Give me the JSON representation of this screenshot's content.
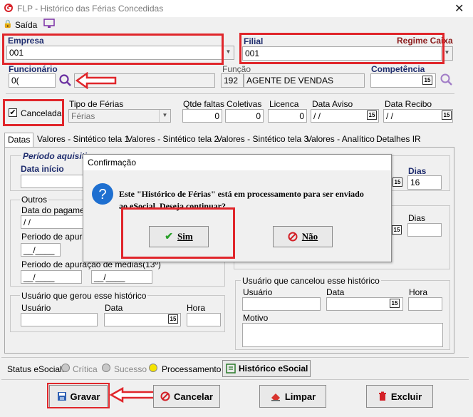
{
  "window": {
    "title": "FLP - Histórico das Férias Concedidas",
    "close": "✕"
  },
  "menu": {
    "saida": "Saída"
  },
  "empresa": {
    "label": "Empresa",
    "value": "001"
  },
  "filial": {
    "label": "Filial",
    "value": "001",
    "regime_label": "Regime Caixa"
  },
  "funcionario": {
    "label": "Funcionário",
    "value": "0("
  },
  "funcao": {
    "label": "Função",
    "code": "192",
    "name": "AGENTE DE VENDAS"
  },
  "competencia": {
    "label": "Competência",
    "value": ""
  },
  "cancelada": {
    "label": "Cancelada",
    "checked": true
  },
  "tipo_ferias": {
    "label": "Tipo de Férias",
    "value": "Férias"
  },
  "qtde_faltas": {
    "label": "Qtde faltas",
    "value": "0"
  },
  "coletivas": {
    "label": "Coletivas",
    "value": "0"
  },
  "licenca": {
    "label": "Licenca",
    "value": "0"
  },
  "data_aviso": {
    "label": "Data Aviso",
    "value": " / /"
  },
  "data_recibo": {
    "label": "Data Recibo",
    "value": " / /"
  },
  "tabs": [
    "Datas",
    "Valores - Sintético tela 1",
    "Valores - Sintético tela 2",
    "Valores - Sintético tela 3",
    "Valores - Analítico",
    "Detalhes IR"
  ],
  "datas": {
    "periodo_aquisitivo": "Período aquisiti",
    "data_inicio": "Data início",
    "dias_label": "Dias",
    "dias_value": "16",
    "dias2_label": "Dias",
    "outros": "Outros",
    "data_pagamento": "Data do pagament",
    "data_pagamento_value": " / /",
    "periodo_apuracao": "Periodo de apuraçã",
    "periodo_apuracao_value": "__/____",
    "periodo_medias": "Periodo de apuração de médias(13º)",
    "periodo_medias_value1": "__/____",
    "periodo_medias_value2": "__/____",
    "usuario_gerou": "Usuário que gerou esse histórico",
    "usuario_label": "Usuário",
    "data_label": "Data",
    "hora_label": "Hora",
    "usuario_cancelou": "Usuário que cancelou esse histórico",
    "usuario2_label": "Usuário",
    "data2_label": "Data",
    "hora2_label": "Hora",
    "motivo_label": "Motivo"
  },
  "dialog": {
    "title": "Confirmação",
    "message_line1": "Este \"Histórico de Férias\" está em processamento para ser enviado",
    "message_line2": "ao eSocial. Deseja continuar?",
    "yes": "Sim",
    "no": "Não"
  },
  "status_bar": {
    "label": "Status eSocial:",
    "critica": "Crítica",
    "sucesso": "Sucesso",
    "processamento": "Processamento",
    "historico_button": "Histórico eSocial"
  },
  "buttons": {
    "gravar": "Gravar",
    "cancelar": "Cancelar",
    "limpar": "Limpar",
    "excluir": "Excluir"
  },
  "colors": {
    "highlight": "#e0262b",
    "label_blue": "#1f2d6e",
    "processamento_dot": "#f5e400"
  }
}
